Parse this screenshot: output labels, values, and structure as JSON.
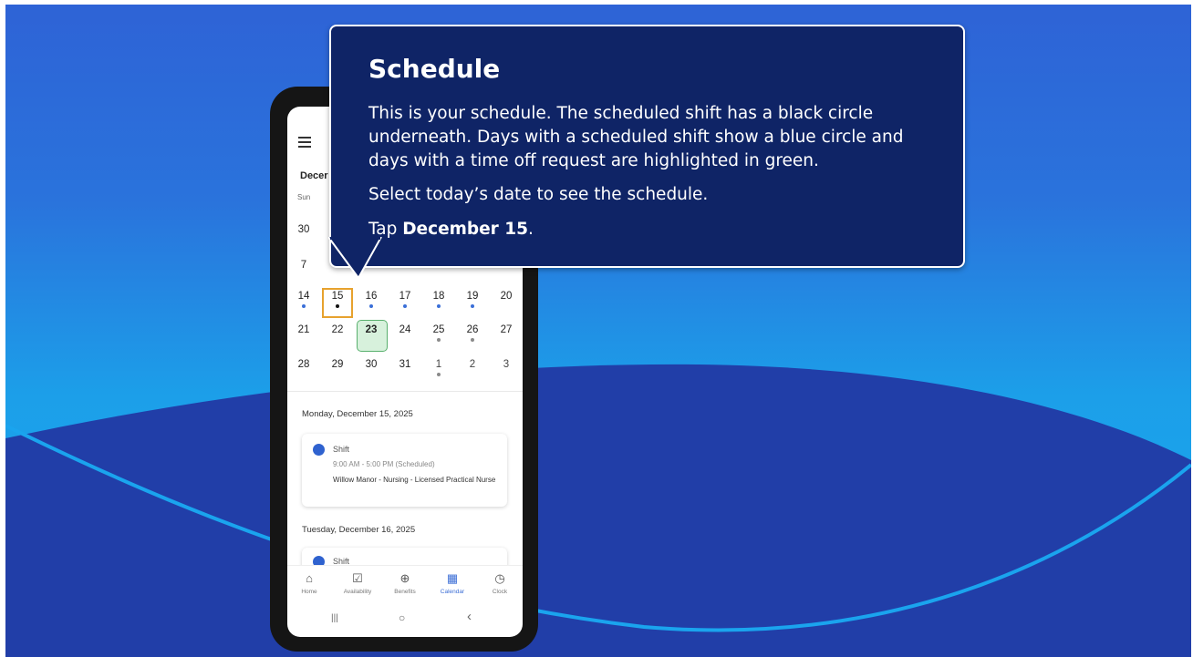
{
  "tooltip": {
    "title": "Schedule",
    "body": "This is your schedule. The scheduled shift has a black circle underneath. Days with a scheduled shift show a blue circle and days with a time off request are highlighted in green.",
    "instruction": "Select today’s date to see the schedule.",
    "tap_prefix": "Tap ",
    "tap_target": "December 15",
    "tap_suffix": "."
  },
  "phone": {
    "month_label": "Decer",
    "weekday_label": "Sun",
    "calendar": {
      "partial_rows": [
        {
          "day": "30"
        },
        {
          "day": "7"
        }
      ],
      "rows": [
        [
          {
            "day": "14",
            "dot": "blue"
          },
          {
            "day": "15",
            "dot": "black",
            "selected": true
          },
          {
            "day": "16",
            "dot": "blue"
          },
          {
            "day": "17",
            "dot": "blue"
          },
          {
            "day": "18",
            "dot": "blue"
          },
          {
            "day": "19",
            "dot": "blue"
          },
          {
            "day": "20"
          }
        ],
        [
          {
            "day": "21"
          },
          {
            "day": "22"
          },
          {
            "day": "23",
            "time_off": true
          },
          {
            "day": "24"
          },
          {
            "day": "25",
            "dot": "grey"
          },
          {
            "day": "26",
            "dot": "grey"
          },
          {
            "day": "27"
          }
        ],
        [
          {
            "day": "28"
          },
          {
            "day": "29"
          },
          {
            "day": "30"
          },
          {
            "day": "31"
          },
          {
            "day": "1",
            "dot": "grey",
            "muted": true
          },
          {
            "day": "2",
            "muted": true
          },
          {
            "day": "3",
            "muted": true
          }
        ]
      ]
    },
    "days": [
      {
        "date": "Monday, December 15, 2025",
        "shift_title": "Shift",
        "time": "9:00 AM - 5:00 PM (Scheduled)",
        "location": "Willow Manor - Nursing - Licensed Practical Nurse"
      },
      {
        "date": "Tuesday, December 16, 2025",
        "shift_title": "Shift"
      }
    ],
    "nav": [
      {
        "label": "Home",
        "icon": "home-icon",
        "glyph": "⌂"
      },
      {
        "label": "Availability",
        "icon": "availability-icon",
        "glyph": "☑"
      },
      {
        "label": "Benefits",
        "icon": "benefits-icon",
        "glyph": "⊕"
      },
      {
        "label": "Calendar",
        "icon": "calendar-icon",
        "glyph": "▦",
        "active": true
      },
      {
        "label": "Clock",
        "icon": "clock-icon",
        "glyph": "◷"
      }
    ],
    "system_nav": {
      "recent": "|||",
      "home": "○",
      "back": "‹"
    }
  },
  "colors": {
    "tooltip_bg": "#0f2466",
    "accent_blue": "#3a6fd8",
    "selection_orange": "#e7a22e",
    "time_off_green": "#d7f1dc"
  }
}
